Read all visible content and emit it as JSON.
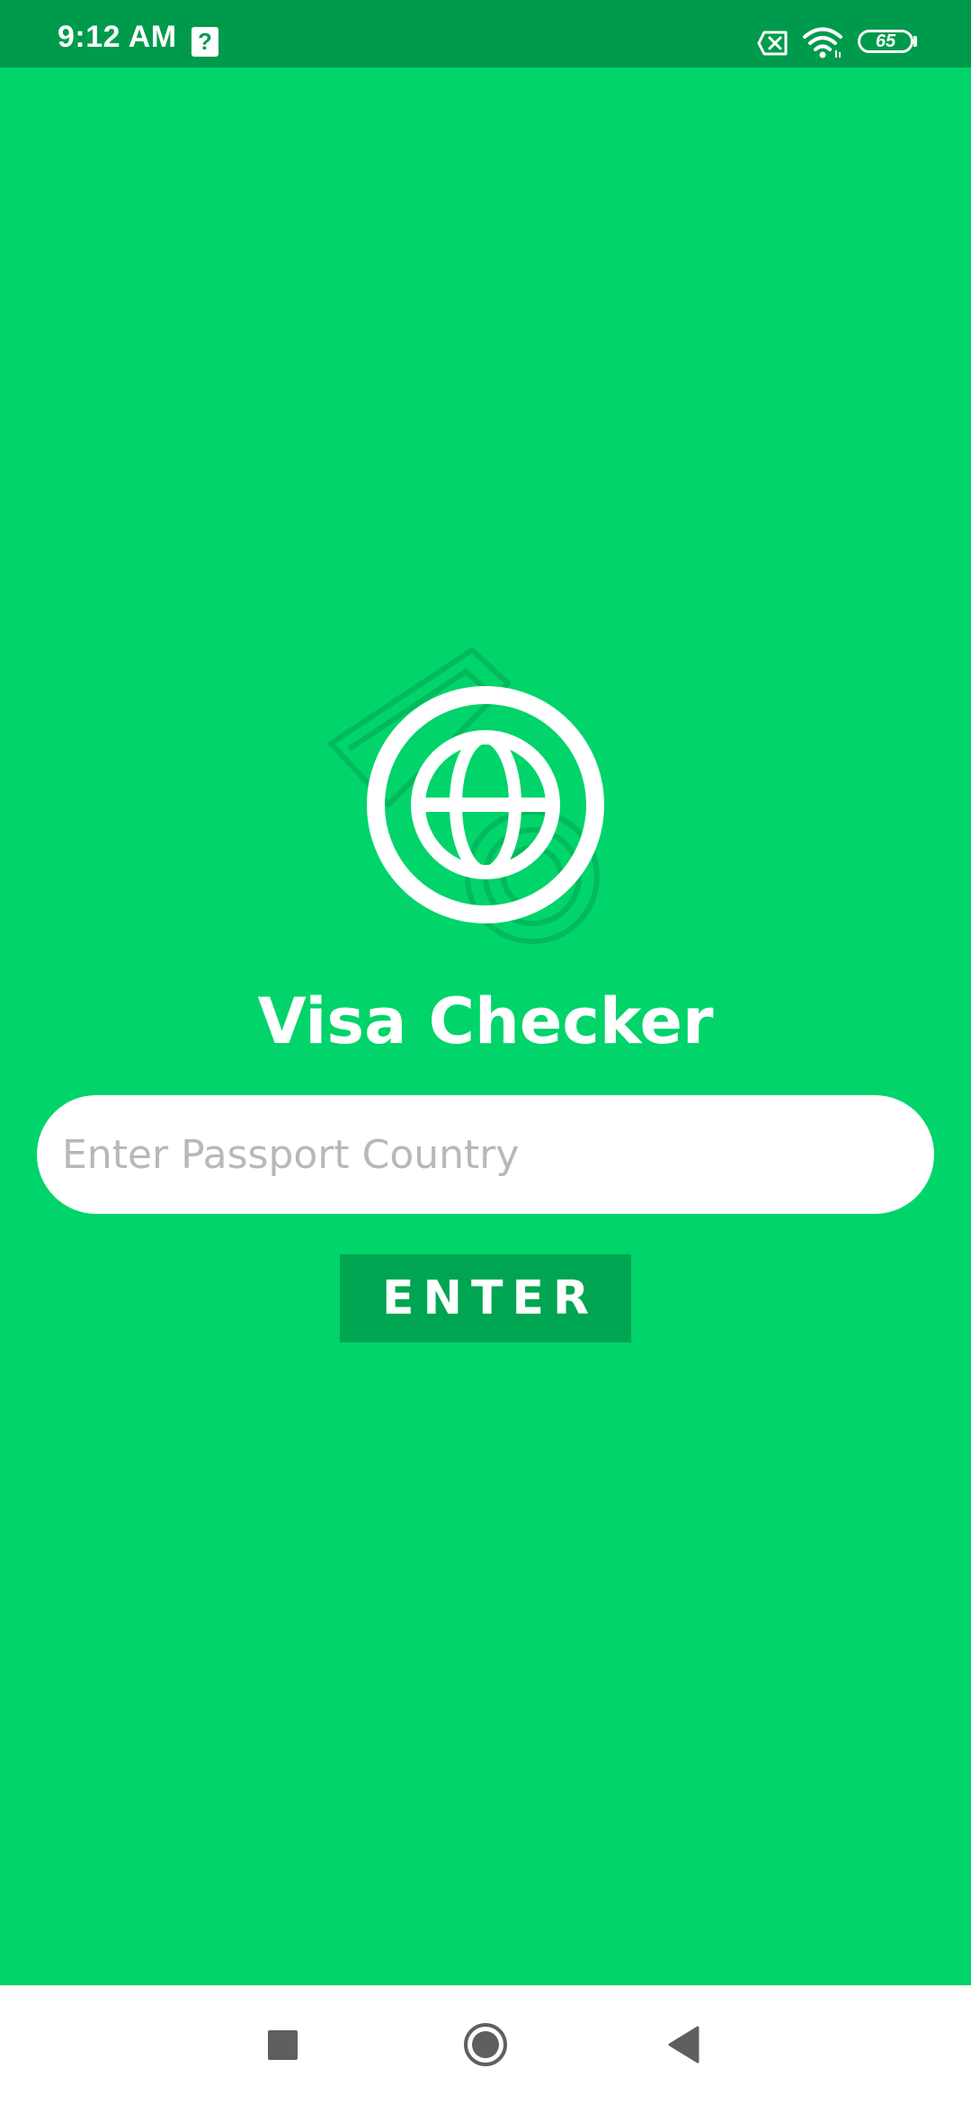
{
  "status_bar": {
    "time": "9:12 AM",
    "help_glyph": "?",
    "battery_level": "65",
    "icons": [
      "help-icon",
      "sim-off-icon",
      "wifi-icon",
      "battery-icon"
    ]
  },
  "main": {
    "title": "Visa Checker",
    "logo_icon": "globe-passport-icon",
    "search": {
      "placeholder": "Enter Passport Country",
      "value": ""
    },
    "enter_button_label": "ENTER"
  },
  "nav_bar": {
    "icons": [
      "recents-icon",
      "home-icon",
      "back-icon"
    ]
  },
  "colors": {
    "background": "#00d46a",
    "status_bar": "#009a4d",
    "button": "#00a552",
    "text": "#ffffff"
  }
}
